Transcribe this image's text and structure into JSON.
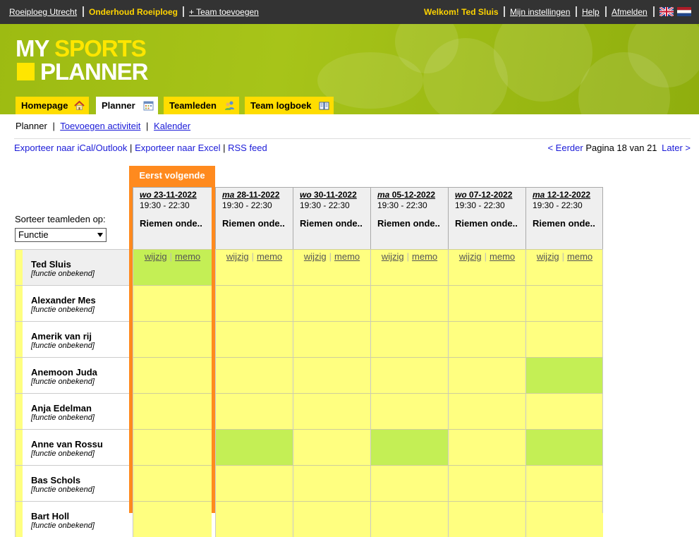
{
  "topbar": {
    "team_link": "Roeiploeg Utrecht",
    "maintenance": "Onderhoud Roeiploeg",
    "add_team": "+ Team toevoegen",
    "welcome": "Welkom! Ted Sluis",
    "settings": "Mijn instellingen",
    "help": "Help",
    "logout": "Afmelden"
  },
  "logo": {
    "my": "MY",
    "sports": "SPORTS",
    "planner": "PLANNER"
  },
  "tabs": [
    {
      "label": "Homepage",
      "icon": "home-icon"
    },
    {
      "label": "Planner",
      "icon": "calendar-icon"
    },
    {
      "label": "Teamleden",
      "icon": "people-icon"
    },
    {
      "label": "Team logboek",
      "icon": "book-icon"
    }
  ],
  "subnav": {
    "current": "Planner",
    "add_activity": "Toevoegen activiteit",
    "calendar": "Kalender",
    "sep": "|"
  },
  "exports": {
    "ical": "Exporteer naar iCal/Outlook",
    "excel": "Exporteer naar Excel",
    "rss": "RSS feed"
  },
  "paging": {
    "prev": "< Eerder",
    "info": "Pagina 18 van 21",
    "next": "Later >"
  },
  "first_next_label": "Eerst volgende",
  "sort": {
    "label": "Sorteer teamleden op:",
    "selected": "Functie"
  },
  "dates": [
    {
      "day": "wo",
      "date": "23-11-2022",
      "time": "19:30 - 22:30",
      "activity": "Riemen onde.."
    },
    {
      "day": "ma",
      "date": "28-11-2022",
      "time": "19:30 - 22:30",
      "activity": "Riemen onde.."
    },
    {
      "day": "wo",
      "date": "30-11-2022",
      "time": "19:30 - 22:30",
      "activity": "Riemen onde.."
    },
    {
      "day": "ma",
      "date": "05-12-2022",
      "time": "19:30 - 22:30",
      "activity": "Riemen onde.."
    },
    {
      "day": "wo",
      "date": "07-12-2022",
      "time": "19:30 - 22:30",
      "activity": "Riemen onde.."
    },
    {
      "day": "ma",
      "date": "12-12-2022",
      "time": "19:30 - 22:30",
      "activity": "Riemen onde.."
    }
  ],
  "actions": {
    "edit": "wijzig",
    "memo": "memo",
    "sep": "|"
  },
  "members": [
    {
      "name": "Ted Sluis",
      "function": "[functie onbekend]",
      "status": [
        "g",
        "y",
        "y",
        "y",
        "y",
        "y"
      ]
    },
    {
      "name": "Alexander Mes",
      "function": "[functie onbekend]",
      "status": [
        "y",
        "y",
        "y",
        "y",
        "y",
        "y"
      ]
    },
    {
      "name": "Amerik van rij",
      "function": "[functie onbekend]",
      "status": [
        "y",
        "y",
        "y",
        "y",
        "y",
        "y"
      ]
    },
    {
      "name": "Anemoon Juda",
      "function": "[functie onbekend]",
      "status": [
        "y",
        "y",
        "y",
        "y",
        "y",
        "g"
      ]
    },
    {
      "name": "Anja Edelman",
      "function": "[functie onbekend]",
      "status": [
        "y",
        "y",
        "y",
        "y",
        "y",
        "y"
      ]
    },
    {
      "name": "Anne van Rossu",
      "function": "[functie onbekend]",
      "status": [
        "y",
        "g",
        "y",
        "g",
        "y",
        "g"
      ]
    },
    {
      "name": "Bas Schols",
      "function": "[functie onbekend]",
      "status": [
        "y",
        "y",
        "y",
        "y",
        "y",
        "y"
      ]
    },
    {
      "name": "Bart Holl",
      "function": "[functie onbekend]",
      "status": [
        "y",
        "y",
        "y",
        "y",
        "y",
        "y"
      ]
    }
  ],
  "colors": {
    "available": "#c4ef55",
    "unknown": "#ffff80",
    "accent": "#ff8a1e",
    "brand": "#ffdd00"
  }
}
